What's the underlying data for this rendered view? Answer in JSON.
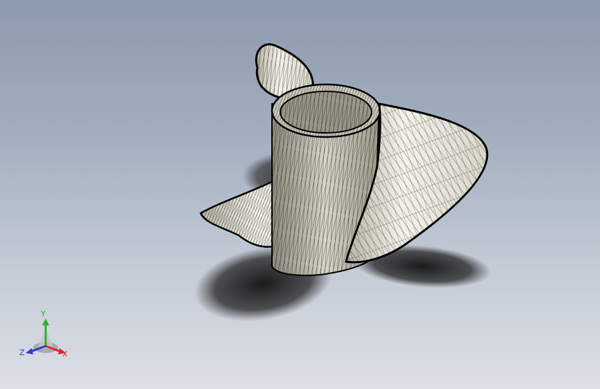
{
  "window": {
    "title": "",
    "background_top": "#8c9aad",
    "background_bottom": "#dcdfe5"
  },
  "model": {
    "name": "propeller-mesh",
    "display_style": "shaded-with-edges",
    "surface_color": "#e9e6dc",
    "edge_color": "#111111",
    "shadow_color": "#1a1a1a"
  },
  "triad": {
    "x_label": "X",
    "y_label": "Y",
    "z_label": "Z",
    "x_color": "#d42a2a",
    "y_color": "#2bb02b",
    "z_color": "#2a3ad4"
  }
}
